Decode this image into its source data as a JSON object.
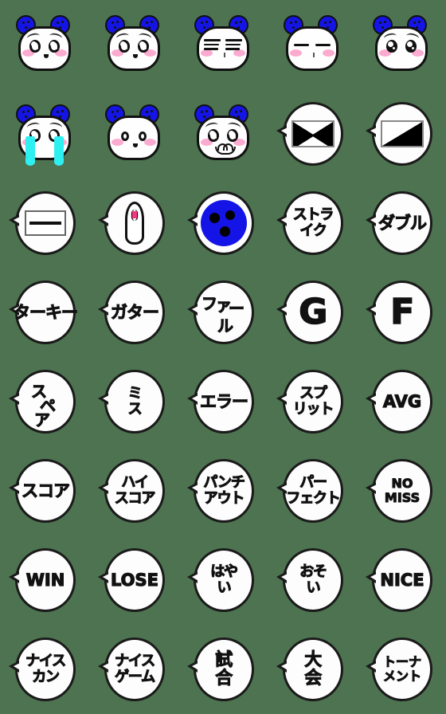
{
  "meta": {
    "title": "Bowling Panda Emoji Sticker Sheet",
    "background_color": "#4d7350",
    "grid_columns": 5,
    "grid_rows": 8,
    "total_cells": 40,
    "accent_blue": "#1414e6",
    "accent_pink": "#fb8fc0",
    "accent_cyan": "#2ff0f0",
    "accent_magenta": "#ef3a7f",
    "ink": "#111111",
    "paper": "#fdfdfd"
  },
  "cells": [
    {
      "id": 1,
      "kind": "face",
      "name": "panda-smile-sparkle-eyes",
      "eyes": "sparkle",
      "brows": true,
      "mouth": "dot",
      "cheeks": true
    },
    {
      "id": 2,
      "kind": "face",
      "name": "panda-smile-sparkle-eyes-2",
      "eyes": "sparkle",
      "brows": true,
      "mouth": "dot",
      "cheeks": true
    },
    {
      "id": 3,
      "kind": "face",
      "name": "panda-closed-bars-eyes",
      "eyes": "bars",
      "brows": false,
      "mouth": "nose",
      "cheeks": true
    },
    {
      "id": 4,
      "kind": "face",
      "name": "panda-flat-slit-eyes",
      "eyes": "slit",
      "brows": false,
      "mouth": "nose",
      "cheeks": true
    },
    {
      "id": 5,
      "kind": "face",
      "name": "panda-teary-big-eyes",
      "eyes": "filled",
      "brows": true,
      "mouth": "none",
      "cheeks": true
    },
    {
      "id": 6,
      "kind": "face",
      "name": "panda-crying-tears",
      "eyes": "sparkle",
      "brows": true,
      "mouth": "none",
      "cheeks": true,
      "tears": true
    },
    {
      "id": 7,
      "kind": "face",
      "name": "panda-surprised-round-eyes",
      "eyes": "round",
      "brows": false,
      "mouth": "dot",
      "cheeks": true
    },
    {
      "id": 8,
      "kind": "face",
      "name": "panda-worried-wavy-mouth",
      "eyes": "sparkle",
      "brows": true,
      "mouth": "wavy",
      "cheeks": true
    },
    {
      "id": 9,
      "kind": "bubble-art",
      "name": "bubble-x-rectangle",
      "art": "rect-x"
    },
    {
      "id": 10,
      "kind": "bubble-art",
      "name": "bubble-half-rectangle",
      "art": "rect-half"
    },
    {
      "id": 11,
      "kind": "bubble-art",
      "name": "bubble-dash-rectangle",
      "art": "rect-dash"
    },
    {
      "id": 12,
      "kind": "bubble-art",
      "name": "bubble-bowling-pin",
      "art": "pin"
    },
    {
      "id": 13,
      "kind": "bubble-art",
      "name": "bubble-bowling-ball",
      "art": "ball"
    },
    {
      "id": 14,
      "kind": "bubble-text",
      "name": "bubble-strike",
      "style": "s2",
      "lines": [
        "ストラ",
        "イク"
      ]
    },
    {
      "id": 15,
      "kind": "bubble-text",
      "name": "bubble-double",
      "style": "s1",
      "lines": [
        "ダブル"
      ]
    },
    {
      "id": 16,
      "kind": "bubble-text",
      "name": "bubble-turkey",
      "style": "s1",
      "lines": [
        "ターキー"
      ]
    },
    {
      "id": 17,
      "kind": "bubble-text",
      "name": "bubble-gutter",
      "style": "s1",
      "lines": [
        "ガター"
      ]
    },
    {
      "id": 18,
      "kind": "bubble-diag2",
      "name": "bubble-foul",
      "chars": [
        "フ",
        "ァ",
        "ー",
        "ル"
      ]
    },
    {
      "id": 19,
      "kind": "bubble-text",
      "name": "bubble-letter-g",
      "style": "sbig",
      "lines": [
        "G"
      ]
    },
    {
      "id": 20,
      "kind": "bubble-text",
      "name": "bubble-letter-f",
      "style": "sbig",
      "lines": [
        "F"
      ]
    },
    {
      "id": 21,
      "kind": "bubble-diag",
      "name": "bubble-spare",
      "chars": [
        "ス",
        "ペ",
        "ア"
      ]
    },
    {
      "id": 22,
      "kind": "bubble-text",
      "name": "bubble-miss",
      "style": "s2",
      "lines": [
        "ミ",
        "ス"
      ]
    },
    {
      "id": 23,
      "kind": "bubble-text",
      "name": "bubble-error",
      "style": "s1",
      "lines": [
        "エラー"
      ]
    },
    {
      "id": 24,
      "kind": "bubble-text",
      "name": "bubble-split",
      "style": "s2",
      "lines": [
        "スプ",
        "リット"
      ]
    },
    {
      "id": 25,
      "kind": "bubble-text",
      "name": "bubble-avg",
      "style": "slat",
      "lines": [
        "AVG"
      ]
    },
    {
      "id": 26,
      "kind": "bubble-text",
      "name": "bubble-score",
      "style": "s1",
      "lines": [
        "スコア"
      ]
    },
    {
      "id": 27,
      "kind": "bubble-text",
      "name": "bubble-high-score",
      "style": "s2",
      "lines": [
        "ハイ",
        "スコア"
      ]
    },
    {
      "id": 28,
      "kind": "bubble-text",
      "name": "bubble-punch-out",
      "style": "s2",
      "lines": [
        "パンチ",
        "アウト"
      ]
    },
    {
      "id": 29,
      "kind": "bubble-text",
      "name": "bubble-perfect",
      "style": "s2",
      "lines": [
        "パー",
        "フェクト"
      ]
    },
    {
      "id": 30,
      "kind": "bubble-text",
      "name": "bubble-no-miss",
      "style": "slat2",
      "lines": [
        "NO",
        "MISS"
      ]
    },
    {
      "id": 31,
      "kind": "bubble-text",
      "name": "bubble-win",
      "style": "slat",
      "lines": [
        "WIN"
      ]
    },
    {
      "id": 32,
      "kind": "bubble-text",
      "name": "bubble-lose",
      "style": "slat",
      "lines": [
        "LOSE"
      ]
    },
    {
      "id": 33,
      "kind": "bubble-text",
      "name": "bubble-hayai",
      "style": "s2",
      "lines": [
        "はや",
        "い"
      ]
    },
    {
      "id": 34,
      "kind": "bubble-text",
      "name": "bubble-osoi",
      "style": "s2",
      "lines": [
        "おそ",
        "い"
      ]
    },
    {
      "id": 35,
      "kind": "bubble-text",
      "name": "bubble-nice",
      "style": "slat",
      "lines": [
        "NICE"
      ]
    },
    {
      "id": 36,
      "kind": "bubble-text",
      "name": "bubble-nice-can",
      "style": "s2",
      "lines": [
        "ナイス",
        "カン"
      ]
    },
    {
      "id": 37,
      "kind": "bubble-text",
      "name": "bubble-nice-game",
      "style": "s2",
      "lines": [
        "ナイス",
        "ゲーム"
      ]
    },
    {
      "id": 38,
      "kind": "bubble-text",
      "name": "bubble-shiai",
      "style": "skanji",
      "lines": [
        "試",
        "合"
      ]
    },
    {
      "id": 39,
      "kind": "bubble-text",
      "name": "bubble-taikai",
      "style": "skanji",
      "lines": [
        "大",
        "会"
      ]
    },
    {
      "id": 40,
      "kind": "bubble-text",
      "name": "bubble-tournament",
      "style": "slat2",
      "lines": [
        "トーナ",
        "メント"
      ]
    }
  ]
}
